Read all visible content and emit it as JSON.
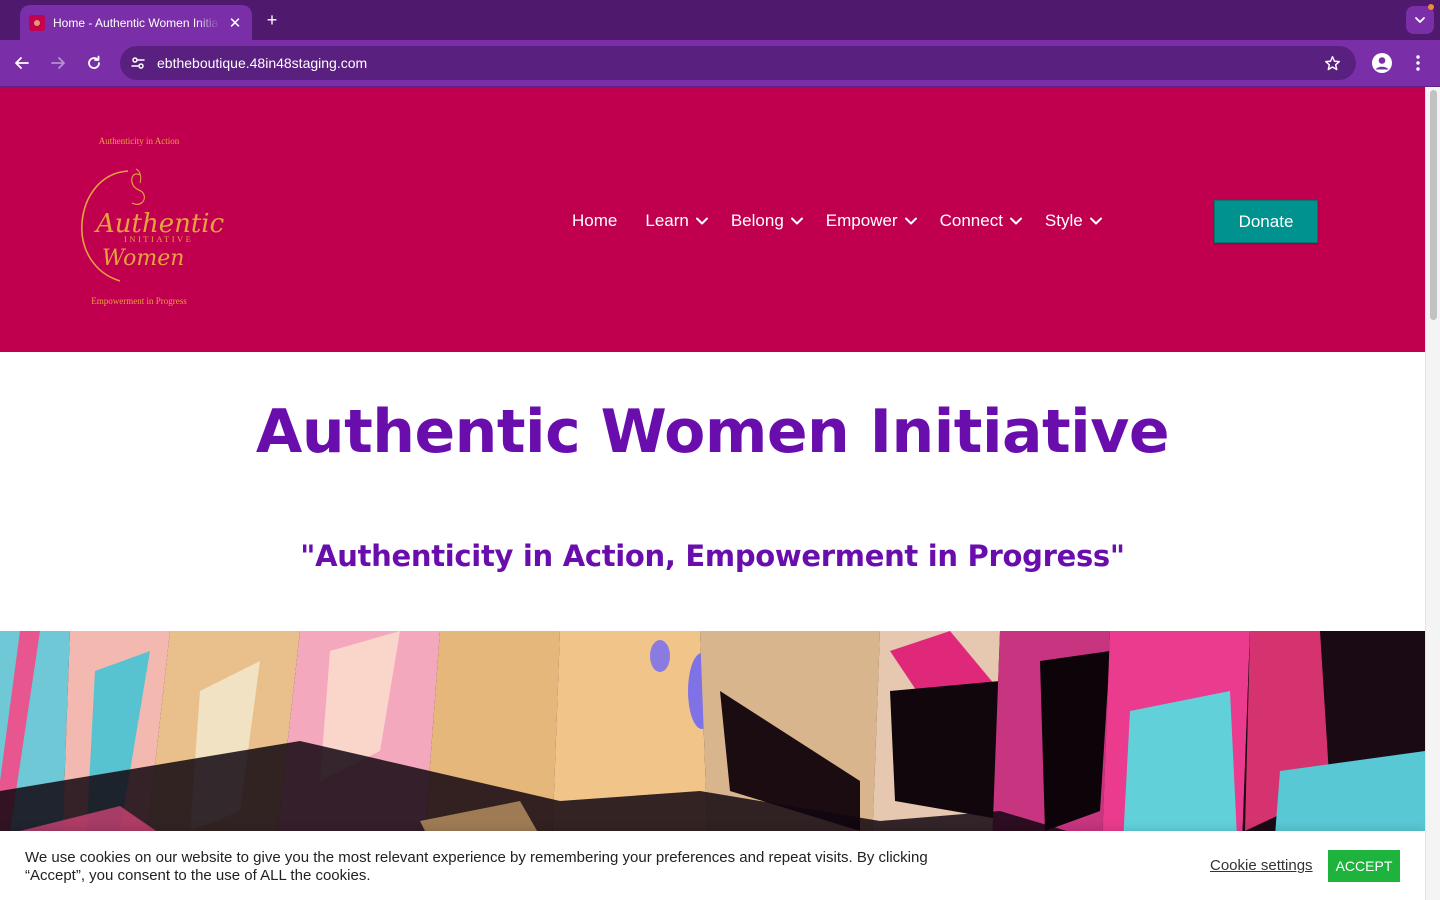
{
  "browser": {
    "tab_title": "Home - Authentic Women Initiative",
    "tab_close": "✕",
    "new_tab": "+",
    "url": "ebtheboutique.48in48staging.com"
  },
  "header": {
    "logo": {
      "top_text": "Authenticity in Action",
      "script_line1": "Authentic",
      "caps_line": "INITIATIVE",
      "script_line2": "Women",
      "bottom_text": "Empowerment in Progress"
    },
    "nav": [
      {
        "label": "Home",
        "has_dropdown": false
      },
      {
        "label": "Learn",
        "has_dropdown": true
      },
      {
        "label": "Belong",
        "has_dropdown": true
      },
      {
        "label": "Empower",
        "has_dropdown": true
      },
      {
        "label": "Connect",
        "has_dropdown": true
      },
      {
        "label": "Style",
        "has_dropdown": true
      }
    ],
    "donate_label": "Donate"
  },
  "hero": {
    "title": "Authentic Women Initiative",
    "subtitle": "\"Authenticity in Action, Empowerment in Progress\""
  },
  "cookie": {
    "text": "We use cookies on our website to give you the most relevant experience by remembering your preferences and repeat visits. By clicking “Accept”, you consent to the use of ALL the cookies.",
    "settings_label": "Cookie settings",
    "accept_label": "ACCEPT"
  },
  "colors": {
    "browser_frame": "#4f1a6e",
    "browser_toolbar": "#7a2fa8",
    "header_bg": "#c0004f",
    "title_purple": "#6a0dad",
    "donate_teal": "#00928e",
    "logo_gold": "#e5a23d",
    "accept_green": "#1db33d"
  }
}
